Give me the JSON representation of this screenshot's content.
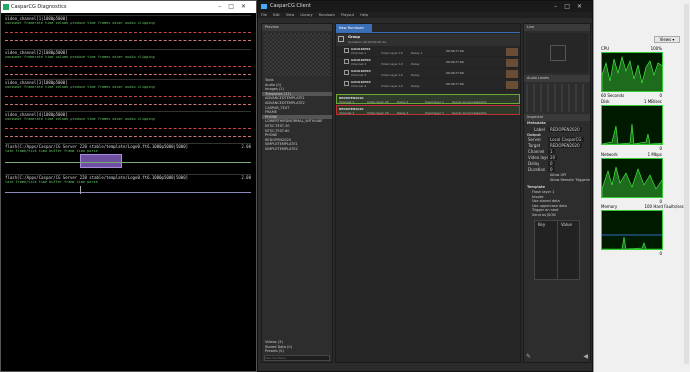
{
  "diag": {
    "title": "CasparCG Diagnostics",
    "channels": [
      {
        "header": "video_channel[1|1080p5000]",
        "sub": "consumer framerate time volume produce time frames mixer audio clipping"
      },
      {
        "header": "video_channel[2|1080p5000]",
        "sub": "consumer framerate time volume produce time frames mixer audio clipping"
      },
      {
        "header": "video_channel[3|1080p5000]",
        "sub": "consumer framerate time volume produce time frames mixer audio clipping"
      },
      {
        "header": "video_channel[4|1080p5000]",
        "sub": "consumer framerate time volume produce time frames mixer audio clipping"
      }
    ],
    "flash1": {
      "header": "flash[C:/Apps/Caspar/CG Server 220 stable/template/Logo0.ft6.1080p5000|5000]",
      "value": "2.00",
      "sub": "late frame/tick time buffer frame time parse"
    },
    "flash2": {
      "header": "flash[C:/Apps/Caspar/CG Server 220 stable/template/Logo0.ft6.1080p5000|5000]",
      "value": "2.00",
      "sub": "late frame/tick time buffer frame time parse"
    }
  },
  "client": {
    "title": "CasparCG Client",
    "menu": [
      "File",
      "Edit",
      "View",
      "Library",
      "Rundown",
      "Playout",
      "Help"
    ],
    "preview_label": "Preview",
    "library_tabs": [
      "Tools",
      "Audio (0)",
      "Images (1)",
      "Templates (11)"
    ],
    "library_items": [
      "ADVANCEDTEMPLATE1",
      "ADVANCEDTEMPLATE2",
      "CASPAR_TEXT",
      "FRAME",
      "PHONE",
      "LOWERTHIRDNORMAL_WITHLINE",
      "NTSC-TEST-30",
      "NTSC-TEST-60",
      "PHONE",
      "REDOPEN2020",
      "SIMPLETEMPLATE1",
      "SIMPLETEMPLATE2"
    ],
    "library_footer": [
      "Videos (3)",
      "Stored Data (0)",
      "Presets (0)"
    ],
    "filter_placeholder": "Filter the library...",
    "rundown_tab": "New Rundown",
    "group": {
      "name": "Group",
      "sub": "Somebox 00:00:00:00  Aa",
      "items": [
        {
          "name": "GO1010P01",
          "channel": "Channel 1",
          "layer": "Video layer 10",
          "delay": "Delay 1",
          "time": "00:00:??:00"
        },
        {
          "name": "GO1010P02",
          "channel": "Channel 2",
          "layer": "Video layer 10",
          "delay": "Delay",
          "time": "00:00:??:00"
        },
        {
          "name": "GO1010P03",
          "channel": "Channel 3",
          "layer": "Video layer 10",
          "delay": "Delay",
          "time": "00:00:??:00"
        },
        {
          "name": "GO1010P04",
          "channel": "Channel 4",
          "layer": "Video layer 10",
          "delay": "Delay",
          "time": "00:00:??:00"
        }
      ]
    },
    "green_rows": [
      {
        "name": "REDOPEN2020",
        "channel": "Channel 1",
        "layer": "Video layer 20",
        "delay": "Delay 2",
        "extra": "Used layer 1",
        "server": "Server Local CasparCG"
      },
      {
        "name": "REDOPEN2020",
        "channel": "Channel 1",
        "layer": "Video layer 20",
        "delay": "Delay 2",
        "extra": "Used layer 1",
        "server": "Server Local CasparCG"
      }
    ],
    "live_label": "Live",
    "audio_levels_label": "Audio Levels",
    "inspector_label": "Inspector",
    "metadata_label": "Metadata",
    "label_key": "Label",
    "label_val": "REDOPEN2020",
    "output_label": "Output",
    "output_fields": [
      {
        "k": "Server",
        "v": "Local CasparCG"
      },
      {
        "k": "Target",
        "v": "REDOPEN2020"
      },
      {
        "k": "Channel",
        "v": "1"
      },
      {
        "k": "Video layer",
        "v": "20"
      },
      {
        "k": "Delay",
        "v": "0"
      },
      {
        "k": "Duration",
        "v": "0"
      }
    ],
    "allow_gpi": "Allow GPI",
    "allow_remote": "Allow Remote Triggering",
    "template_label": "Template",
    "template_fields": [
      {
        "k": "Flash layer",
        "v": "1"
      },
      {
        "k": "Invoke",
        "v": ""
      },
      {
        "k": "Use stored data",
        "v": ""
      },
      {
        "k": "Use uppercase data",
        "v": ""
      },
      {
        "k": "Trigger on next",
        "v": ""
      },
      {
        "k": "Send as JSON",
        "v": ""
      }
    ],
    "kv_headers": [
      "Key",
      "Value"
    ]
  },
  "perf": {
    "button": "Views",
    "graphs": [
      {
        "label": "CPU",
        "value": "100%",
        "foot": "60 Seconds",
        "foot2": "0"
      },
      {
        "label": "Disk",
        "value": "1 MB/sec",
        "foot": "",
        "foot2": "0"
      },
      {
        "label": "Network",
        "value": "1 Mbps",
        "foot": "",
        "foot2": "0"
      },
      {
        "label": "Memory",
        "value": "100 Hard Faults/sec",
        "foot": "",
        "foot2": "0"
      }
    ]
  }
}
